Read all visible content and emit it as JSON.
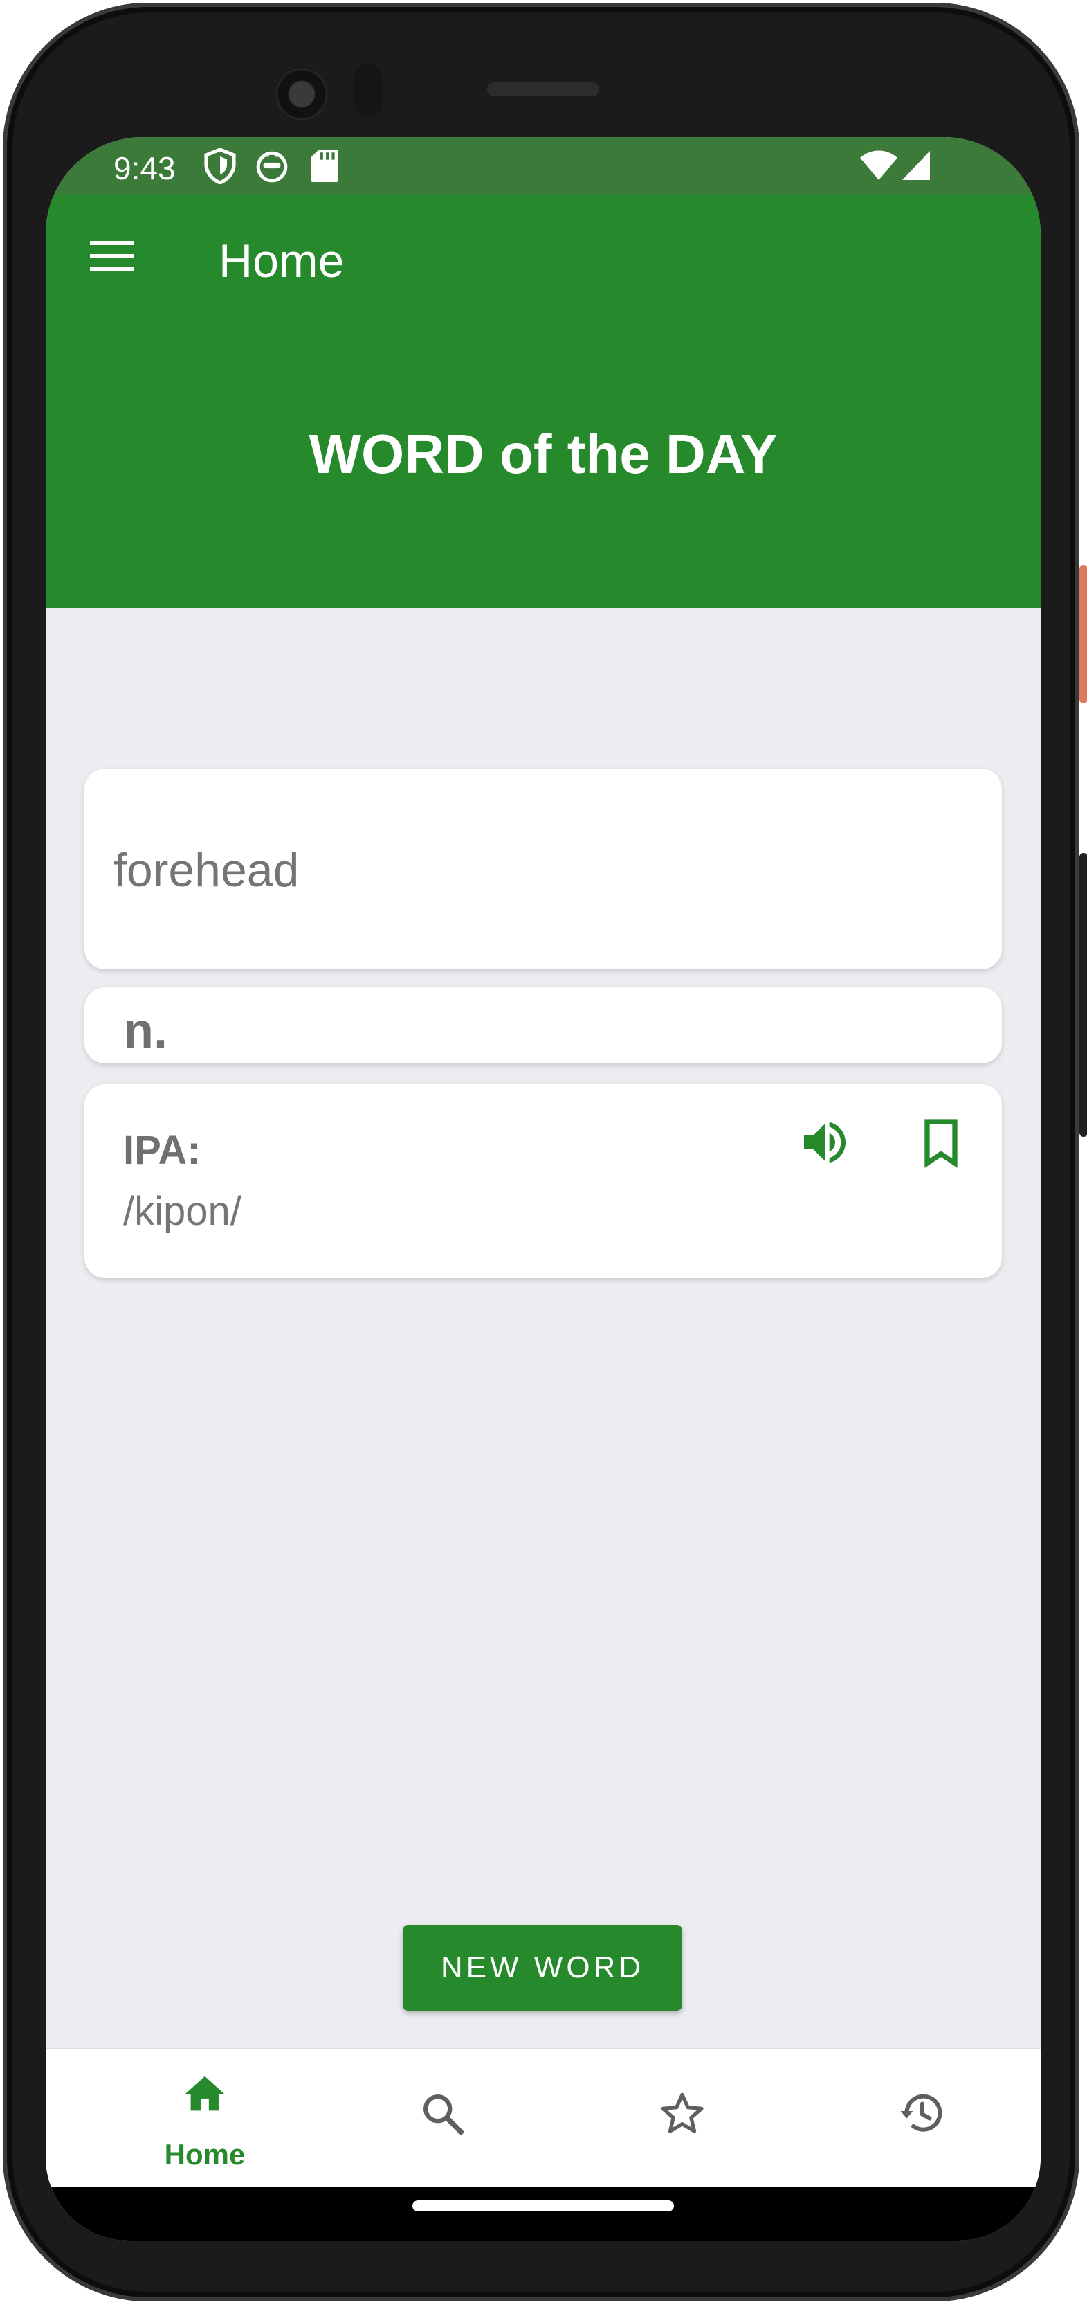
{
  "status_bar": {
    "time": "9:43",
    "icons": [
      "shield-icon",
      "cat-face-icon",
      "sd-card-icon",
      "wifi-icon",
      "cellular-signal-icon"
    ]
  },
  "app_bar": {
    "title": "Home",
    "menu_icon": "hamburger-menu-icon"
  },
  "hero": {
    "title": "WORD of the DAY"
  },
  "word_card": {
    "word": "forehead"
  },
  "pos_card": {
    "part_of_speech": "n."
  },
  "ipa_card": {
    "label": "IPA:",
    "value": "/kipon/",
    "speak_icon": "volume-up-icon",
    "bookmark_icon": "bookmark-outline-icon"
  },
  "actions": {
    "new_word_label": "NEW WORD"
  },
  "bottom_nav": {
    "items": [
      {
        "label": "Home",
        "icon": "home-icon",
        "active": true
      },
      {
        "label": "",
        "icon": "search-icon",
        "active": false
      },
      {
        "label": "",
        "icon": "star-outline-icon",
        "active": false
      },
      {
        "label": "",
        "icon": "history-icon",
        "active": false
      }
    ]
  },
  "colors": {
    "primary": "#268a2d",
    "status_bar": "#3b7a39",
    "background": "#ecedf1",
    "text_secondary": "#757575",
    "icon_inactive": "#5f5f5f"
  }
}
